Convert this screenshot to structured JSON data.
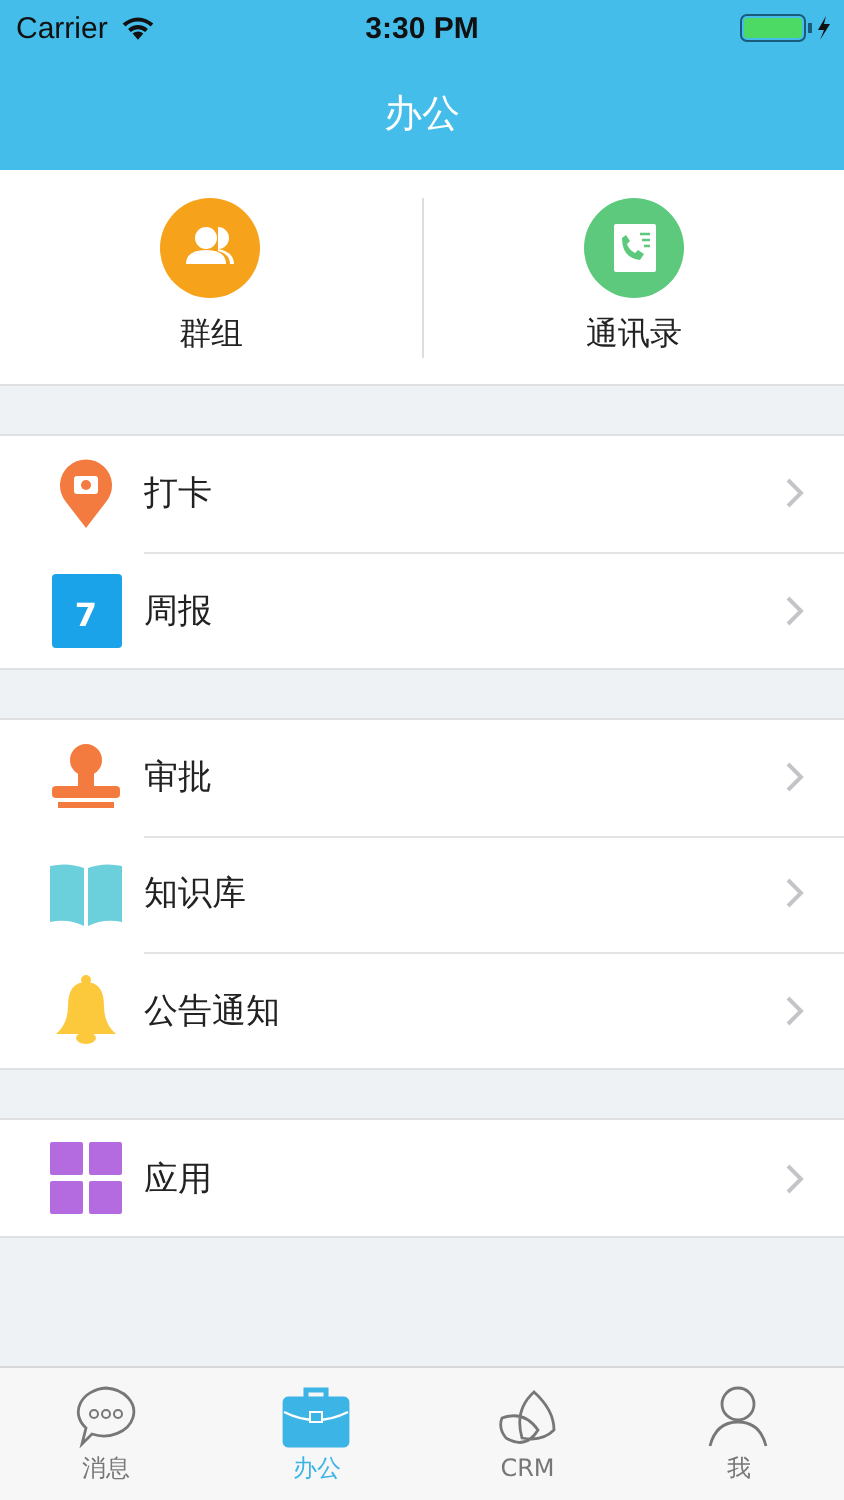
{
  "status_bar": {
    "carrier": "Carrier",
    "time": "3:30 PM"
  },
  "nav": {
    "title": "办公"
  },
  "shortcuts": [
    {
      "kind": "group",
      "label": "群组"
    },
    {
      "kind": "contacts",
      "label": "通讯录"
    }
  ],
  "sections": [
    {
      "items": [
        {
          "kind": "checkin",
          "label": "打卡"
        },
        {
          "kind": "calendar",
          "label": "周报",
          "icon_text": "7"
        }
      ]
    },
    {
      "items": [
        {
          "kind": "stamp",
          "label": "审批"
        },
        {
          "kind": "book",
          "label": "知识库"
        },
        {
          "kind": "bell",
          "label": "公告通知"
        }
      ]
    },
    {
      "items": [
        {
          "kind": "apps",
          "label": "应用"
        }
      ]
    }
  ],
  "tabs": [
    {
      "kind": "chat",
      "label": "消息",
      "selected": false
    },
    {
      "kind": "briefcase",
      "label": "办公",
      "selected": true
    },
    {
      "kind": "crm",
      "label": "CRM",
      "selected": false
    },
    {
      "kind": "person",
      "label": "我",
      "selected": false
    }
  ]
}
